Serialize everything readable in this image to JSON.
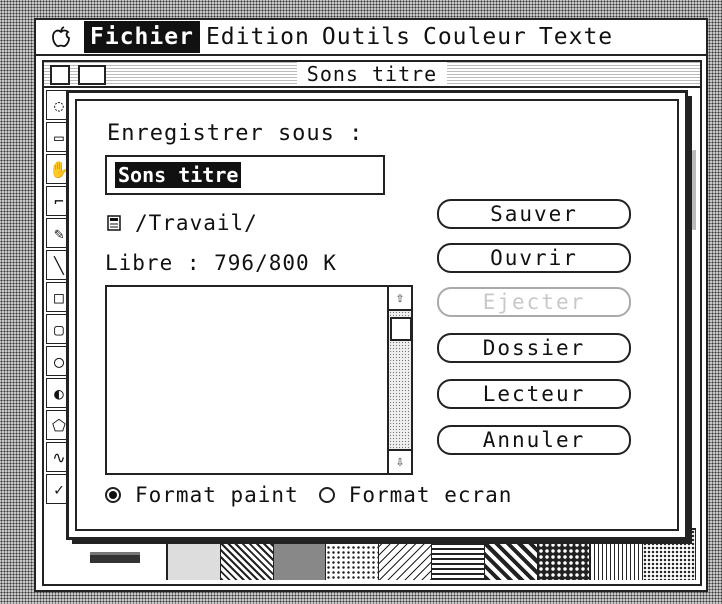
{
  "menubar": {
    "apple_icon": "apple-icon",
    "items": [
      {
        "label": "Fichier",
        "active": true
      },
      {
        "label": "Edition"
      },
      {
        "label": "Outils"
      },
      {
        "label": "Couleur"
      },
      {
        "label": "Texte"
      }
    ]
  },
  "paint_window": {
    "title": "Sons titre"
  },
  "dialog": {
    "title": "Enregistrer sous :",
    "filename_value": "Sons titre",
    "path": "/Travail/",
    "free_space": "Libre : 796/800 K",
    "buttons": {
      "save": "Sauver",
      "open": "Ouvrir",
      "eject": "Ejecter",
      "folder": "Dossier",
      "drive": "Lecteur",
      "cancel": "Annuler"
    },
    "formats": {
      "paint": "Format paint",
      "screen": "Format ecran",
      "selected": "paint"
    }
  }
}
